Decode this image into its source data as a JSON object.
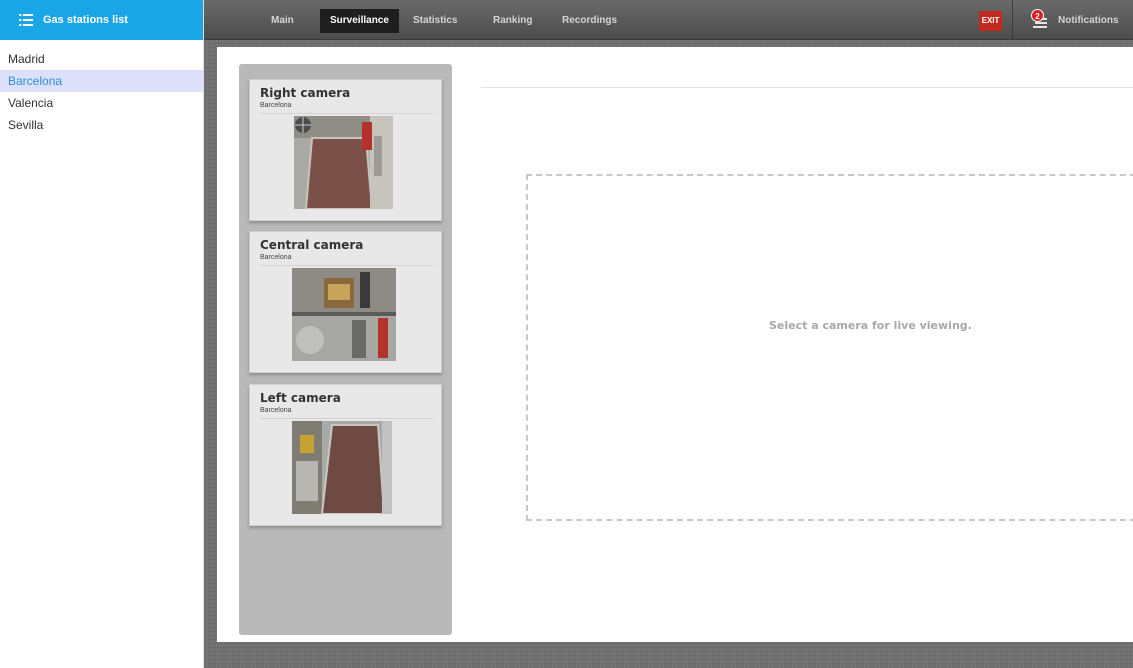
{
  "sidebar": {
    "title": "Gas stations list",
    "items": [
      {
        "label": "Madrid",
        "active": false
      },
      {
        "label": "Barcelona",
        "active": true
      },
      {
        "label": "Valencia",
        "active": false
      },
      {
        "label": "Sevilla",
        "active": false
      }
    ]
  },
  "nav": {
    "tabs": [
      {
        "label": "Main",
        "active": false
      },
      {
        "label": "Surveillance",
        "active": true
      },
      {
        "label": "Statistics",
        "active": false
      },
      {
        "label": "Ranking",
        "active": false
      },
      {
        "label": "Recordings",
        "active": false
      }
    ],
    "exit_label": "EXIT",
    "notifications_label": "Notifications",
    "notifications_count": "2"
  },
  "cameras": [
    {
      "name": "Right camera",
      "location": "Barcelona"
    },
    {
      "name": "Central camera",
      "location": "Barcelona"
    },
    {
      "name": "Left camera",
      "location": "Barcelona"
    }
  ],
  "viewer": {
    "message": "Select a camera for live viewing."
  },
  "colors": {
    "sidebar_header": "#1aa6e6",
    "active_item_bg": "#dde0fb",
    "active_item_text": "#2b8fd6",
    "exit_button": "#c22a1f",
    "notification_badge": "#d82020"
  },
  "icons": [
    "list-icon",
    "notifications-icon"
  ]
}
